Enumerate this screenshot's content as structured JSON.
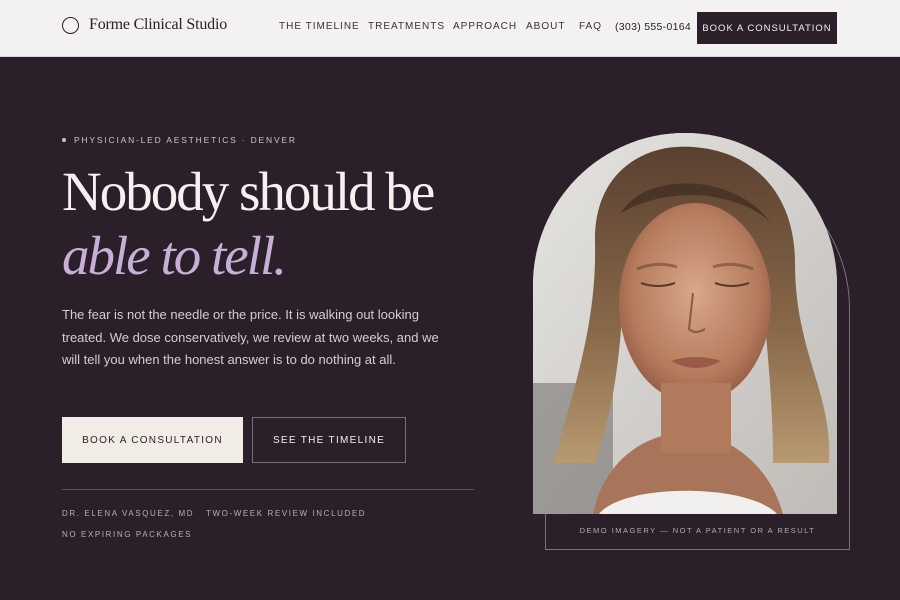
{
  "header": {
    "brand": "Forme Clinical Studio",
    "nav": [
      "THE TIMELINE",
      "TREATMENTS",
      "APPROACH",
      "ABOUT",
      "FAQ"
    ],
    "phone": "(303) 555-0164",
    "cta": "BOOK A CONSULTATION"
  },
  "hero": {
    "eyebrow": "PHYSICIAN-LED AESTHETICS · DENVER",
    "headline_line1": "Nobody should be",
    "headline_line2": "able to tell.",
    "body": "The fear is not the needle or the price. It is walking out looking treated. We dose conservatively, we review at two weeks, and we will tell you when the honest answer is to do nothing at all.",
    "primary_button": "BOOK A CONSULTATION",
    "secondary_button": "SEE THE TIMELINE",
    "meta": [
      "DR. ELENA VASQUEZ, MD",
      "TWO-WEEK REVIEW INCLUDED",
      "NO EXPIRING PACKAGES"
    ],
    "image_caption": "DEMO IMAGERY — NOT A PATIENT OR A RESULT"
  },
  "colors": {
    "background": "#2b2029",
    "header_bg": "#f3f1f1",
    "accent": "#c9aed7",
    "cream": "#f2ece6"
  }
}
